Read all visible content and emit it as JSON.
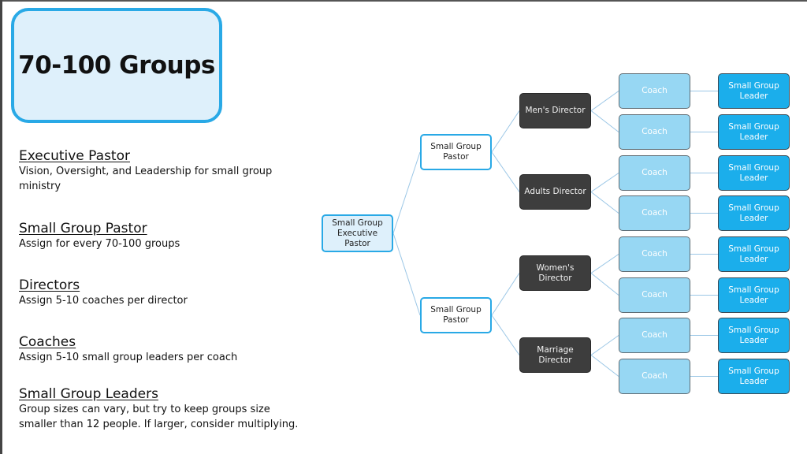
{
  "title": "70-100 Groups",
  "notes": [
    {
      "heading": "Executive Pastor",
      "lines": [
        "Vision, Oversight, and Leadership for small group",
        "ministry"
      ]
    },
    {
      "heading": "Small Group Pastor",
      "lines": [
        "Assign for every 70-100 groups"
      ]
    },
    {
      "heading": "Directors",
      "lines": [
        "Assign 5-10 coaches per director"
      ]
    },
    {
      "heading": "Coaches",
      "lines": [
        "Assign 5-10 small group leaders per coach"
      ]
    },
    {
      "heading": "Small Group Leaders",
      "lines": [
        "Group sizes can vary, but try to keep groups size",
        "smaller than 12 people.  If larger, consider multiplying."
      ]
    }
  ],
  "org_chart": {
    "executive": "Small Group Executive Pastor",
    "pastors": [
      {
        "label": "Small Group Pastor",
        "directors": [
          {
            "label": "Men's Director",
            "coaches": [
              "Coach",
              "Coach"
            ]
          },
          {
            "label": "Adults Director",
            "coaches": [
              "Coach",
              "Coach"
            ]
          }
        ]
      },
      {
        "label": "Small Group Pastor",
        "directors": [
          {
            "label": "Women's Director",
            "coaches": [
              "Coach",
              "Coach"
            ]
          },
          {
            "label": "Marriage Director",
            "coaches": [
              "Coach",
              "Coach"
            ]
          }
        ]
      }
    ],
    "leader_label": "Small Group Leader"
  },
  "colors": {
    "accent_border": "#29a9e6",
    "light_fill": "#def0fb",
    "director_fill": "#3d3d3d",
    "coach_fill": "#97d7f3",
    "leader_fill": "#1baeeb",
    "connector": "#9cc7e6"
  }
}
